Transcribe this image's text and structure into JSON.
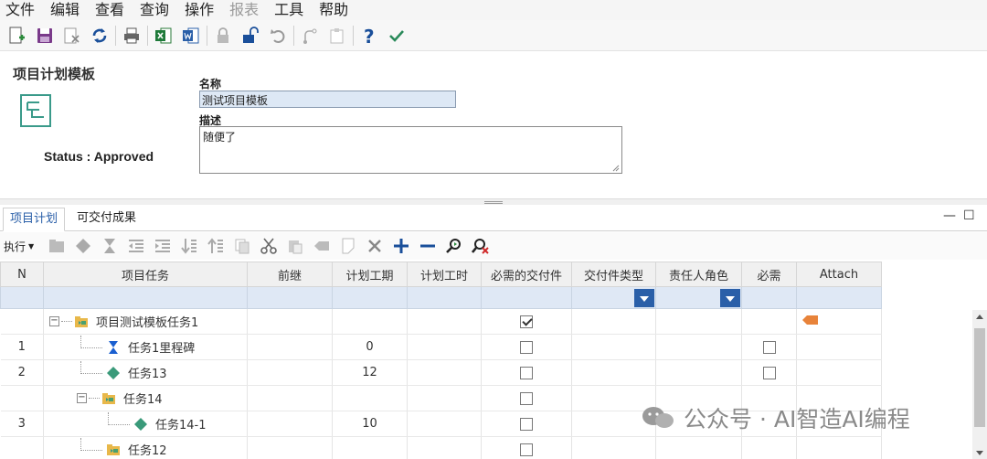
{
  "menu": [
    "文件",
    "编辑",
    "查看",
    "查询",
    "操作",
    "报表",
    "工具",
    "帮助"
  ],
  "menu_disabled": [
    "报表"
  ],
  "toolbar_icons": [
    "new-icon",
    "save-icon",
    "delete-icon",
    "refresh-icon",
    "print-icon",
    "excel-icon",
    "word-icon",
    "lock-icon",
    "unlock-icon",
    "undo-icon",
    "branch-icon",
    "paste-icon",
    "help-icon",
    "check-icon"
  ],
  "header": {
    "title": "项目计划模板",
    "status": "Status : Approved",
    "name_label": "名称",
    "name_value": "测试项目模板",
    "desc_label": "描述",
    "desc_value": "随便了"
  },
  "tabs": [
    "项目计划",
    "可交付成果"
  ],
  "grid_toolbar": {
    "exec_label": "执行",
    "icons": [
      "folder-icon",
      "diamond-icon",
      "hourglass-icon",
      "outdent-icon",
      "indent-icon",
      "move-down-icon",
      "move-up-icon",
      "copy-icon",
      "cut-icon",
      "paste-icon",
      "tag-icon",
      "note-icon",
      "remove-icon",
      "add-icon",
      "minus-icon",
      "zoom-in-icon",
      "zoom-clear-icon"
    ]
  },
  "columns": [
    "N",
    "项目任务",
    "前继",
    "计划工期",
    "计划工时",
    "必需的交付件",
    "交付件类型",
    "责任人角色",
    "必需",
    "Attach"
  ],
  "rows": [
    {
      "n": "",
      "task": "项目测试模板任务1",
      "level": 0,
      "type": "folder",
      "expander": true,
      "duration": "",
      "deliverable": true,
      "required": null,
      "attach": true
    },
    {
      "n": "1",
      "task": "任务1里程碑",
      "level": 1,
      "type": "milestone",
      "expander": false,
      "duration": "0",
      "deliverable": false,
      "required": false,
      "attach": false
    },
    {
      "n": "2",
      "task": "任务13",
      "level": 1,
      "type": "diamond",
      "expander": false,
      "duration": "12",
      "deliverable": false,
      "required": false,
      "attach": false
    },
    {
      "n": "",
      "task": "任务14",
      "level": 1,
      "type": "folder",
      "expander": true,
      "duration": "",
      "deliverable": false,
      "required": null,
      "attach": false
    },
    {
      "n": "3",
      "task": "任务14-1",
      "level": 2,
      "type": "diamond",
      "expander": false,
      "duration": "10",
      "deliverable": false,
      "required": null,
      "attach": false
    },
    {
      "n": "",
      "task": "任务12",
      "level": 1,
      "type": "folder",
      "expander": false,
      "duration": "",
      "deliverable": false,
      "required": null,
      "attach": false
    }
  ],
  "watermark": "公众号 · AI智造AI编程",
  "colors": {
    "accent": "#2a5fa8",
    "filter_row": "#dfe8f5",
    "milestone": "#1a5fd0",
    "task_diamond": "#3a9a7a",
    "attach_tag": "#e8833a"
  }
}
